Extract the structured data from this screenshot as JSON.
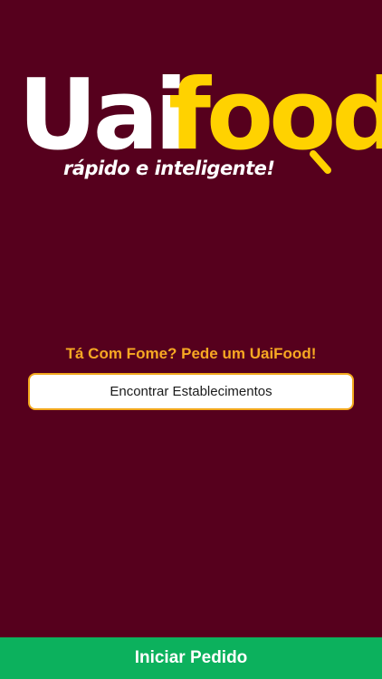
{
  "logo": {
    "word_white": "Uai",
    "word_yellow": "food",
    "tagline": "rápido e inteligente!",
    "colors": {
      "white_part": "#ffffff",
      "yellow_part": "#ffd200"
    }
  },
  "main": {
    "headline": "Tá Com Fome? Pede um UaiFood!",
    "find_button_label": "Encontrar Establecimentos"
  },
  "footer": {
    "start_order_label": "Iniciar Pedido"
  },
  "theme": {
    "background": "#56001d",
    "accent": "#f7a823",
    "primary_action": "#0cb15d"
  }
}
